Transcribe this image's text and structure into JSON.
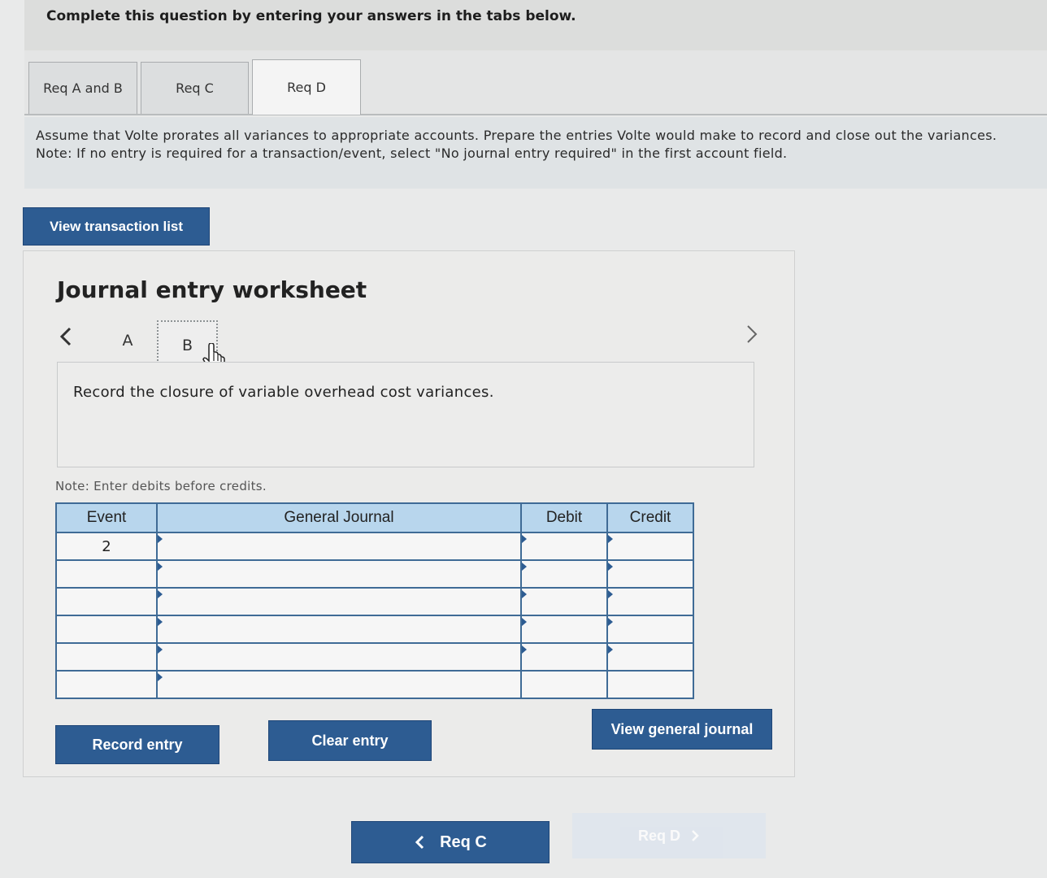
{
  "header": {
    "title": "Complete this question by entering your answers in the tabs below."
  },
  "tabs": [
    {
      "label": "Req A and B",
      "active": false
    },
    {
      "label": "Req C",
      "active": false
    },
    {
      "label": "Req D",
      "active": true
    }
  ],
  "instructions": {
    "line1": "Assume that Volte prorates all variances to appropriate accounts. Prepare the entries Volte would make to record and close out the variances.",
    "line2": "Note: If no entry is required for a transaction/event, select \"No journal entry required\" in the first account field."
  },
  "view_transaction_list_label": "View transaction list",
  "worksheet": {
    "title": "Journal entry worksheet",
    "entry_tabs": [
      "A",
      "B"
    ],
    "active_entry": "B",
    "description": "Record the closure of variable overhead cost variances.",
    "note": "Note: Enter debits before credits.",
    "columns": [
      "Event",
      "General Journal",
      "Debit",
      "Credit"
    ],
    "rows": [
      {
        "event": "2",
        "account": "",
        "debit": "",
        "credit": ""
      },
      {
        "event": "",
        "account": "",
        "debit": "",
        "credit": ""
      },
      {
        "event": "",
        "account": "",
        "debit": "",
        "credit": ""
      },
      {
        "event": "",
        "account": "",
        "debit": "",
        "credit": ""
      },
      {
        "event": "",
        "account": "",
        "debit": "",
        "credit": ""
      },
      {
        "event": "",
        "account": "",
        "debit": "",
        "credit": ""
      }
    ],
    "buttons": {
      "record": "Record entry",
      "clear": "Clear entry",
      "view_journal": "View general journal"
    }
  },
  "bottom_nav": {
    "prev_label": "Req C",
    "next_label": "Req D"
  },
  "icons": {
    "prev": "chevron-left-icon",
    "next": "chevron-right-icon",
    "cursor": "hand-pointer-icon"
  },
  "colors": {
    "button_blue": "#2d5c92",
    "table_header": "#b8d6ed",
    "table_border": "#3f6b96"
  }
}
